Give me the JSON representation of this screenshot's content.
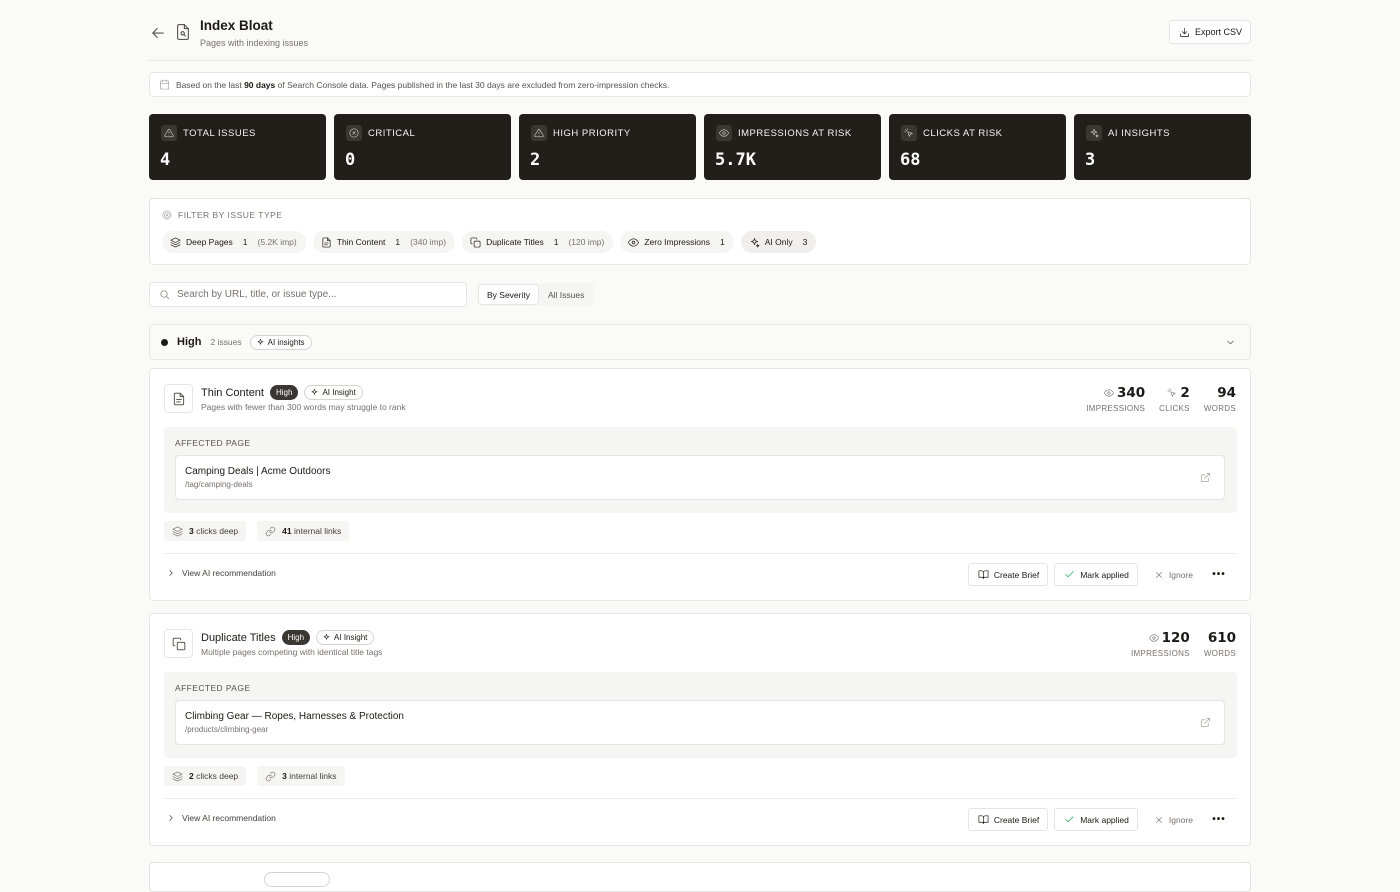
{
  "header": {
    "title": "Index Bloat",
    "subtitle": "Pages with indexing issues",
    "export_label": "Export CSV"
  },
  "banner": {
    "prefix": "Based on the last",
    "days": "90 days",
    "suffix": "of Search Console data. Pages published in the last 30 days are excluded from zero-impression checks."
  },
  "stats": [
    {
      "label": "TOTAL ISSUES",
      "value": "4",
      "icon": "warning-triangle-icon"
    },
    {
      "label": "CRITICAL",
      "value": "0",
      "icon": "x-circle-icon"
    },
    {
      "label": "HIGH PRIORITY",
      "value": "2",
      "icon": "warning-triangle-icon"
    },
    {
      "label": "IMPRESSIONS AT RISK",
      "value": "5.7K",
      "icon": "eye-icon"
    },
    {
      "label": "CLICKS AT RISK",
      "value": "68",
      "icon": "cursor-click-icon"
    },
    {
      "label": "AI INSIGHTS",
      "value": "3",
      "icon": "sparkles-icon"
    }
  ],
  "filters": {
    "title": "FILTER BY ISSUE TYPE",
    "chips": [
      {
        "label": "Deep Pages",
        "count": "1",
        "impressions": "(5.2K imp)",
        "icon": "layers-icon"
      },
      {
        "label": "Thin Content",
        "count": "1",
        "impressions": "(340 imp)",
        "icon": "document-icon"
      },
      {
        "label": "Duplicate Titles",
        "count": "1",
        "impressions": "(120 imp)",
        "icon": "copy-icon"
      },
      {
        "label": "Zero Impressions",
        "count": "1",
        "impressions": "",
        "icon": "eye-icon"
      },
      {
        "label": "AI Only",
        "count": "3",
        "impressions": "",
        "icon": "sparkles-icon"
      }
    ]
  },
  "search": {
    "placeholder": "Search by URL, title, or issue type...",
    "value": ""
  },
  "view_toggle": {
    "options": [
      "By Severity",
      "All Issues"
    ],
    "selected": "By Severity"
  },
  "group": {
    "name": "High",
    "count": "2 issues",
    "ai_tag": "AI insights"
  },
  "issues": [
    {
      "title": "Thin Content",
      "severity": "High",
      "ai_tag": "AI Insight",
      "description": "Pages with fewer than 300 words may struggle to rank",
      "metrics": [
        {
          "value": "340",
          "label": "IMPRESSIONS",
          "icon": "eye-icon"
        },
        {
          "value": "2",
          "label": "CLICKS",
          "icon": "cursor-click-icon"
        },
        {
          "value": "94",
          "label": "WORDS",
          "icon": ""
        }
      ],
      "affected_label": "AFFECTED PAGE",
      "page_title": "Camping Deals | Acme Outdoors",
      "page_url": "/tag/camping-deals",
      "depth_count": "3",
      "depth_text": "clicks deep",
      "links_count": "41",
      "links_text": "internal links",
      "view_ai": "View AI recommendation",
      "create_brief": "Create Brief",
      "mark_applied": "Mark applied",
      "ignore": "Ignore"
    },
    {
      "title": "Duplicate Titles",
      "severity": "High",
      "ai_tag": "AI Insight",
      "description": "Multiple pages competing with identical title tags",
      "metrics": [
        {
          "value": "120",
          "label": "IMPRESSIONS",
          "icon": "eye-icon"
        },
        {
          "value": "610",
          "label": "WORDS",
          "icon": ""
        }
      ],
      "affected_label": "AFFECTED PAGE",
      "page_title": "Climbing Gear — Ropes, Harnesses & Protection",
      "page_url": "/products/climbing-gear",
      "depth_count": "2",
      "depth_text": "clicks deep",
      "links_count": "3",
      "links_text": "internal links",
      "view_ai": "View AI recommendation",
      "create_brief": "Create Brief",
      "mark_applied": "Mark applied",
      "ignore": "Ignore"
    }
  ]
}
